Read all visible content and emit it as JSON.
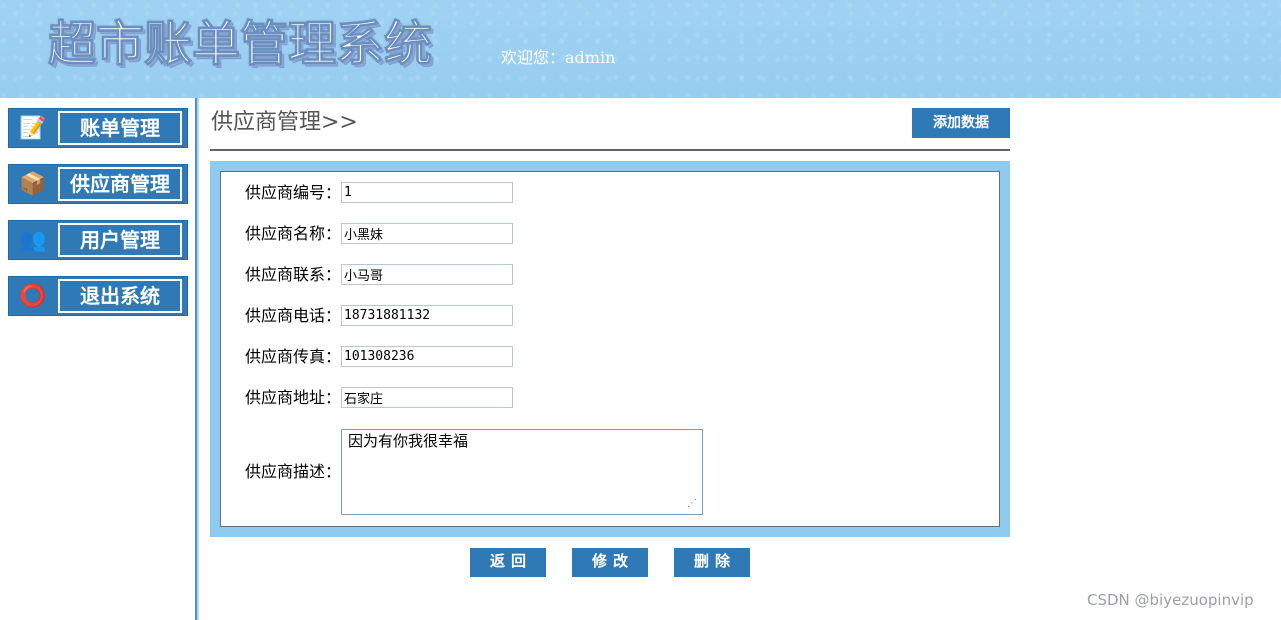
{
  "header": {
    "system_title": "超市账单管理系统",
    "welcome": "欢迎您：admin"
  },
  "sidebar": {
    "items": [
      {
        "label": "账单管理",
        "icon": "bill-edit-icon",
        "icon_glyph": "📝"
      },
      {
        "label": "供应商管理",
        "icon": "supplier-box-icon",
        "icon_glyph": "📦"
      },
      {
        "label": "用户管理",
        "icon": "users-icon",
        "icon_glyph": "👥"
      },
      {
        "label": "退出系统",
        "icon": "lifebuoy-icon",
        "icon_glyph": "⭕"
      }
    ]
  },
  "main": {
    "title": "供应商管理>>",
    "add_button": "添加数据"
  },
  "form": {
    "fields": [
      {
        "label": "供应商编号：",
        "value": "1"
      },
      {
        "label": "供应商名称：",
        "value": "小黑妹"
      },
      {
        "label": "供应商联系：",
        "value": "小马哥"
      },
      {
        "label": "供应商电话：",
        "value": "18731881132"
      },
      {
        "label": "供应商传真：",
        "value": "101308236"
      },
      {
        "label": "供应商地址：",
        "value": "石家庄"
      }
    ],
    "description": {
      "label": "供应商描述：",
      "value": "因为有你我很幸福"
    }
  },
  "actions": {
    "back": "返回",
    "edit": "修改",
    "delete": "删除"
  },
  "watermark": "CSDN @biyezuopinvip",
  "colors": {
    "header_bg": "#9fd2f2",
    "button_blue": "#2f79b7",
    "form_frame": "#8fcaef",
    "divider_blue": "#4f8fcb"
  }
}
